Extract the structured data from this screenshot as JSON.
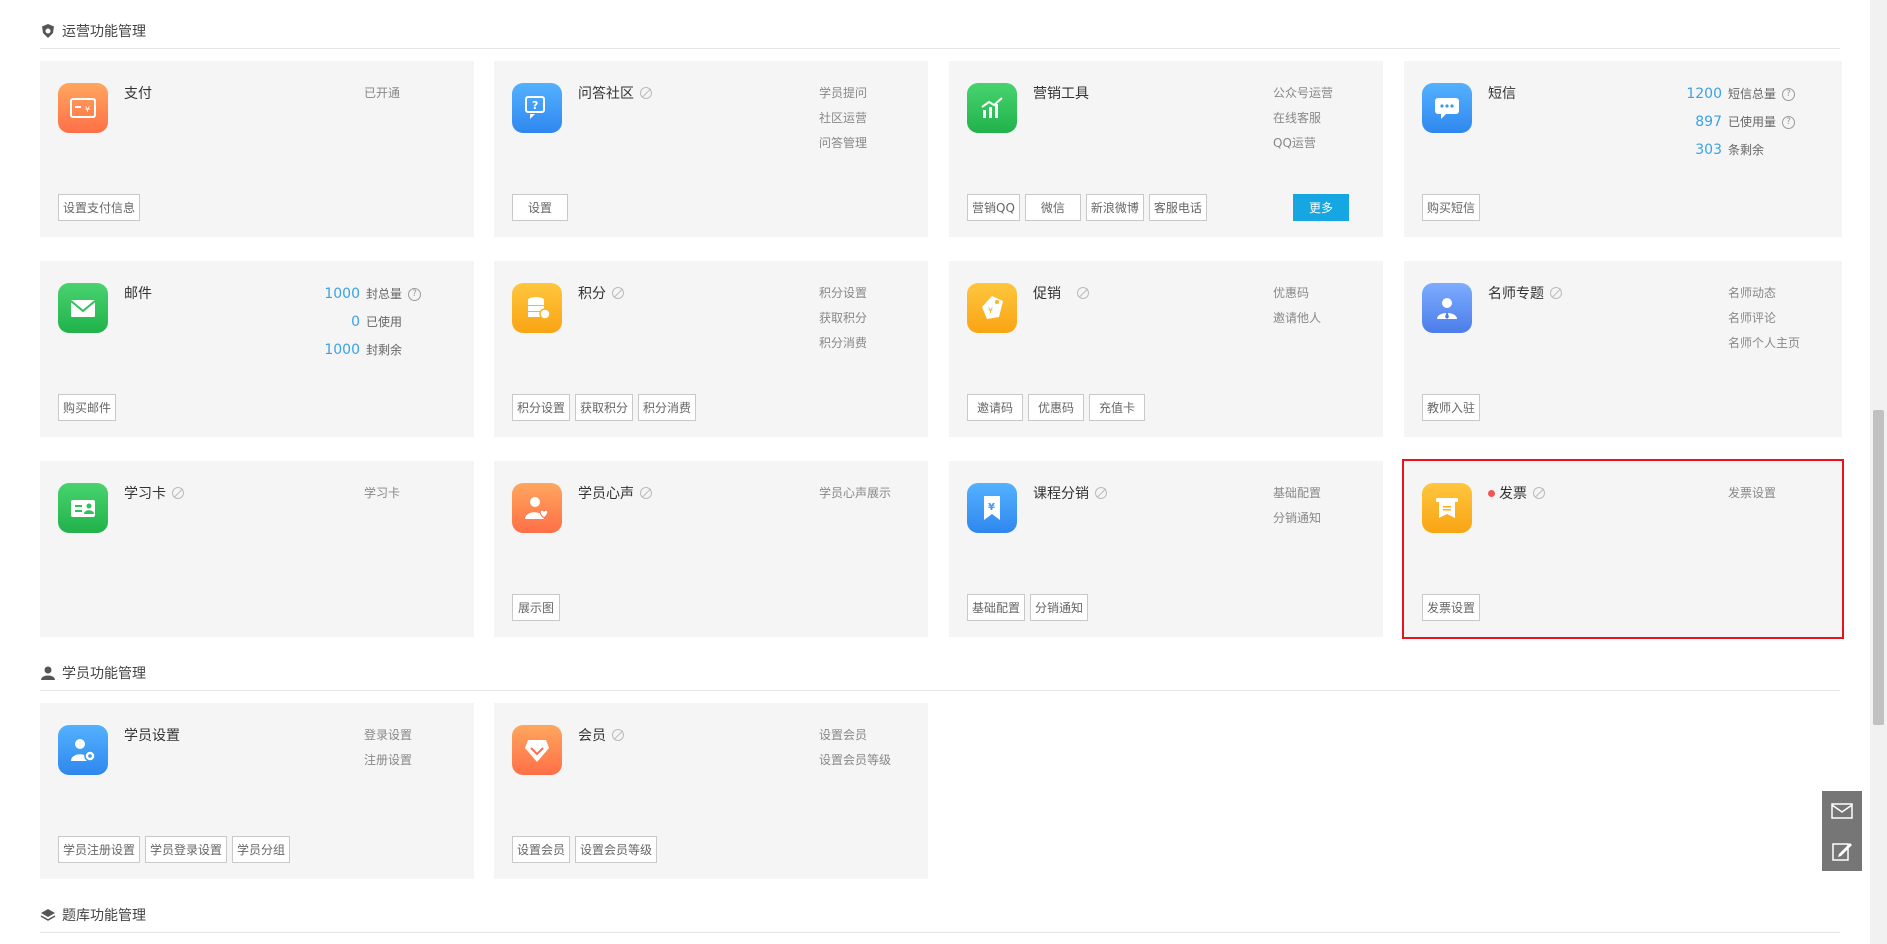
{
  "sections": {
    "operations": "运营功能管理",
    "students": "学员功能管理",
    "question_bank": "题库功能管理"
  },
  "cards": {
    "payment": {
      "title": "支付",
      "links": [
        "已开通"
      ],
      "buttons": [
        "设置支付信息"
      ],
      "icon": "payment-card-icon",
      "color": "#ff8a4c"
    },
    "qa": {
      "title": "问答社区",
      "links": [
        "学员提问",
        "社区运营",
        "问答管理"
      ],
      "buttons": [
        "设置"
      ],
      "icon": "qa-bubble-icon",
      "color": "#3b9bf0"
    },
    "marketing": {
      "title": "营销工具",
      "links": [
        "公众号运营",
        "在线客服",
        "QQ运营"
      ],
      "buttons": [
        "营销QQ",
        "微信",
        "新浪微博",
        "客服电话"
      ],
      "more": "更多",
      "icon": "chart-growth-icon",
      "color": "#2cc25a"
    },
    "sms": {
      "title": "短信",
      "stats": [
        {
          "num": "1200",
          "label": "短信总量",
          "help": "?"
        },
        {
          "num": "897",
          "label": "已使用量",
          "help": "?"
        },
        {
          "num": "303",
          "label": "条剩余"
        }
      ],
      "buttons": [
        "购买短信"
      ],
      "icon": "sms-chat-icon",
      "color": "#3b9bf0"
    },
    "email": {
      "title": "邮件",
      "stats": [
        {
          "num": "1000",
          "label": "封总量",
          "help": "?"
        },
        {
          "num": "0",
          "label": "已使用"
        },
        {
          "num": "1000",
          "label": "封剩余"
        }
      ],
      "buttons": [
        "购买邮件"
      ],
      "icon": "envelope-icon",
      "color": "#2cc25a"
    },
    "points": {
      "title": "积分",
      "links": [
        "积分设置",
        "获取积分",
        "积分消费"
      ],
      "buttons": [
        "积分设置",
        "获取积分",
        "积分消费"
      ],
      "icon": "coins-stack-icon",
      "color": "#fbb322"
    },
    "promotion": {
      "title": "促销",
      "links": [
        "优惠码",
        "邀请他人"
      ],
      "buttons": [
        "邀请码",
        "优惠码",
        "充值卡"
      ],
      "icon": "price-tag-icon",
      "color": "#fbb322"
    },
    "teacher": {
      "title": "名师专题",
      "links": [
        "名师动态",
        "名师评论",
        "名师个人主页"
      ],
      "buttons": [
        "教师入驻"
      ],
      "icon": "teacher-icon",
      "color": "#5b8ef0"
    },
    "study_card": {
      "title": "学习卡",
      "links": [
        "学习卡"
      ],
      "buttons": [],
      "icon": "id-card-icon",
      "color": "#2cc25a"
    },
    "voice": {
      "title": "学员心声",
      "links": [
        "学员心声展示"
      ],
      "buttons": [
        "展示图"
      ],
      "icon": "user-heart-icon",
      "color": "#ff8a4c"
    },
    "distribution": {
      "title": "课程分销",
      "links": [
        "基础配置",
        "分销通知"
      ],
      "buttons": [
        "基础配置",
        "分销通知"
      ],
      "icon": "yen-bookmark-icon",
      "color": "#3b9bf0"
    },
    "invoice": {
      "title": "发票",
      "links": [
        "发票设置"
      ],
      "buttons": [
        "发票设置"
      ],
      "icon": "invoice-icon",
      "color": "#fbb322"
    },
    "student_settings": {
      "title": "学员设置",
      "links": [
        "登录设置",
        "注册设置"
      ],
      "buttons": [
        "学员注册设置",
        "学员登录设置",
        "学员分组"
      ],
      "icon": "user-gear-icon",
      "color": "#3b9bf0"
    },
    "member": {
      "title": "会员",
      "links": [
        "设置会员",
        "设置会员等级"
      ],
      "buttons": [
        "设置会员",
        "设置会员等级"
      ],
      "icon": "member-badge-icon",
      "color": "#ff8a4c"
    }
  },
  "side_tools": [
    "mail-icon",
    "edit-icon"
  ]
}
